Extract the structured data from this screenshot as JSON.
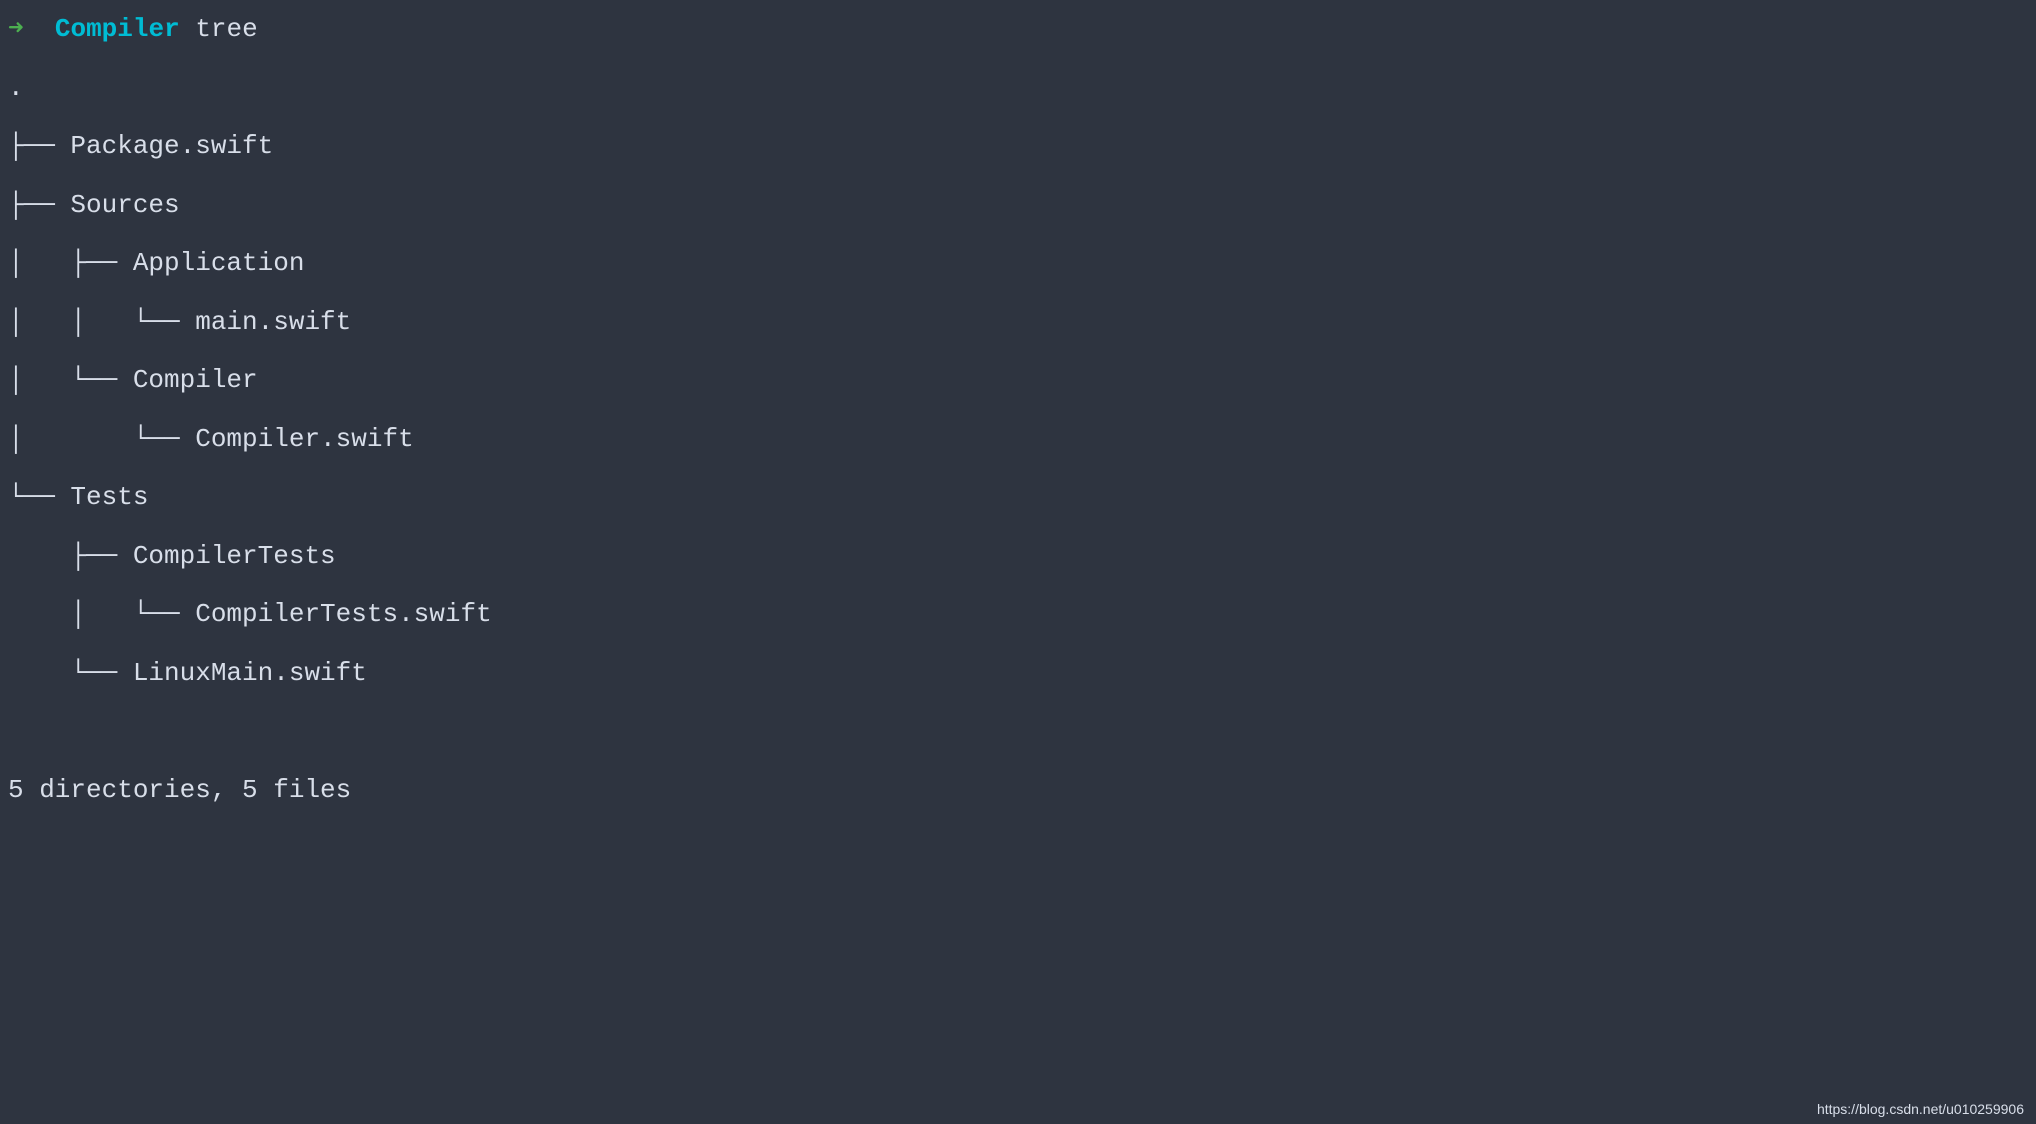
{
  "prompt": {
    "arrow": "➜",
    "dir": "Compiler",
    "command": "tree"
  },
  "tree": {
    "root": ".",
    "lines": [
      "├── Package.swift",
      "├── Sources",
      "│   ├── Application",
      "│   │   └── main.swift",
      "│   └── Compiler",
      "│       └── Compiler.swift",
      "└── Tests",
      "    ├── CompilerTests",
      "    │   └── CompilerTests.swift",
      "    └── LinuxMain.swift"
    ],
    "summary": "5 directories, 5 files"
  },
  "watermark": "https://blog.csdn.net/u010259906"
}
